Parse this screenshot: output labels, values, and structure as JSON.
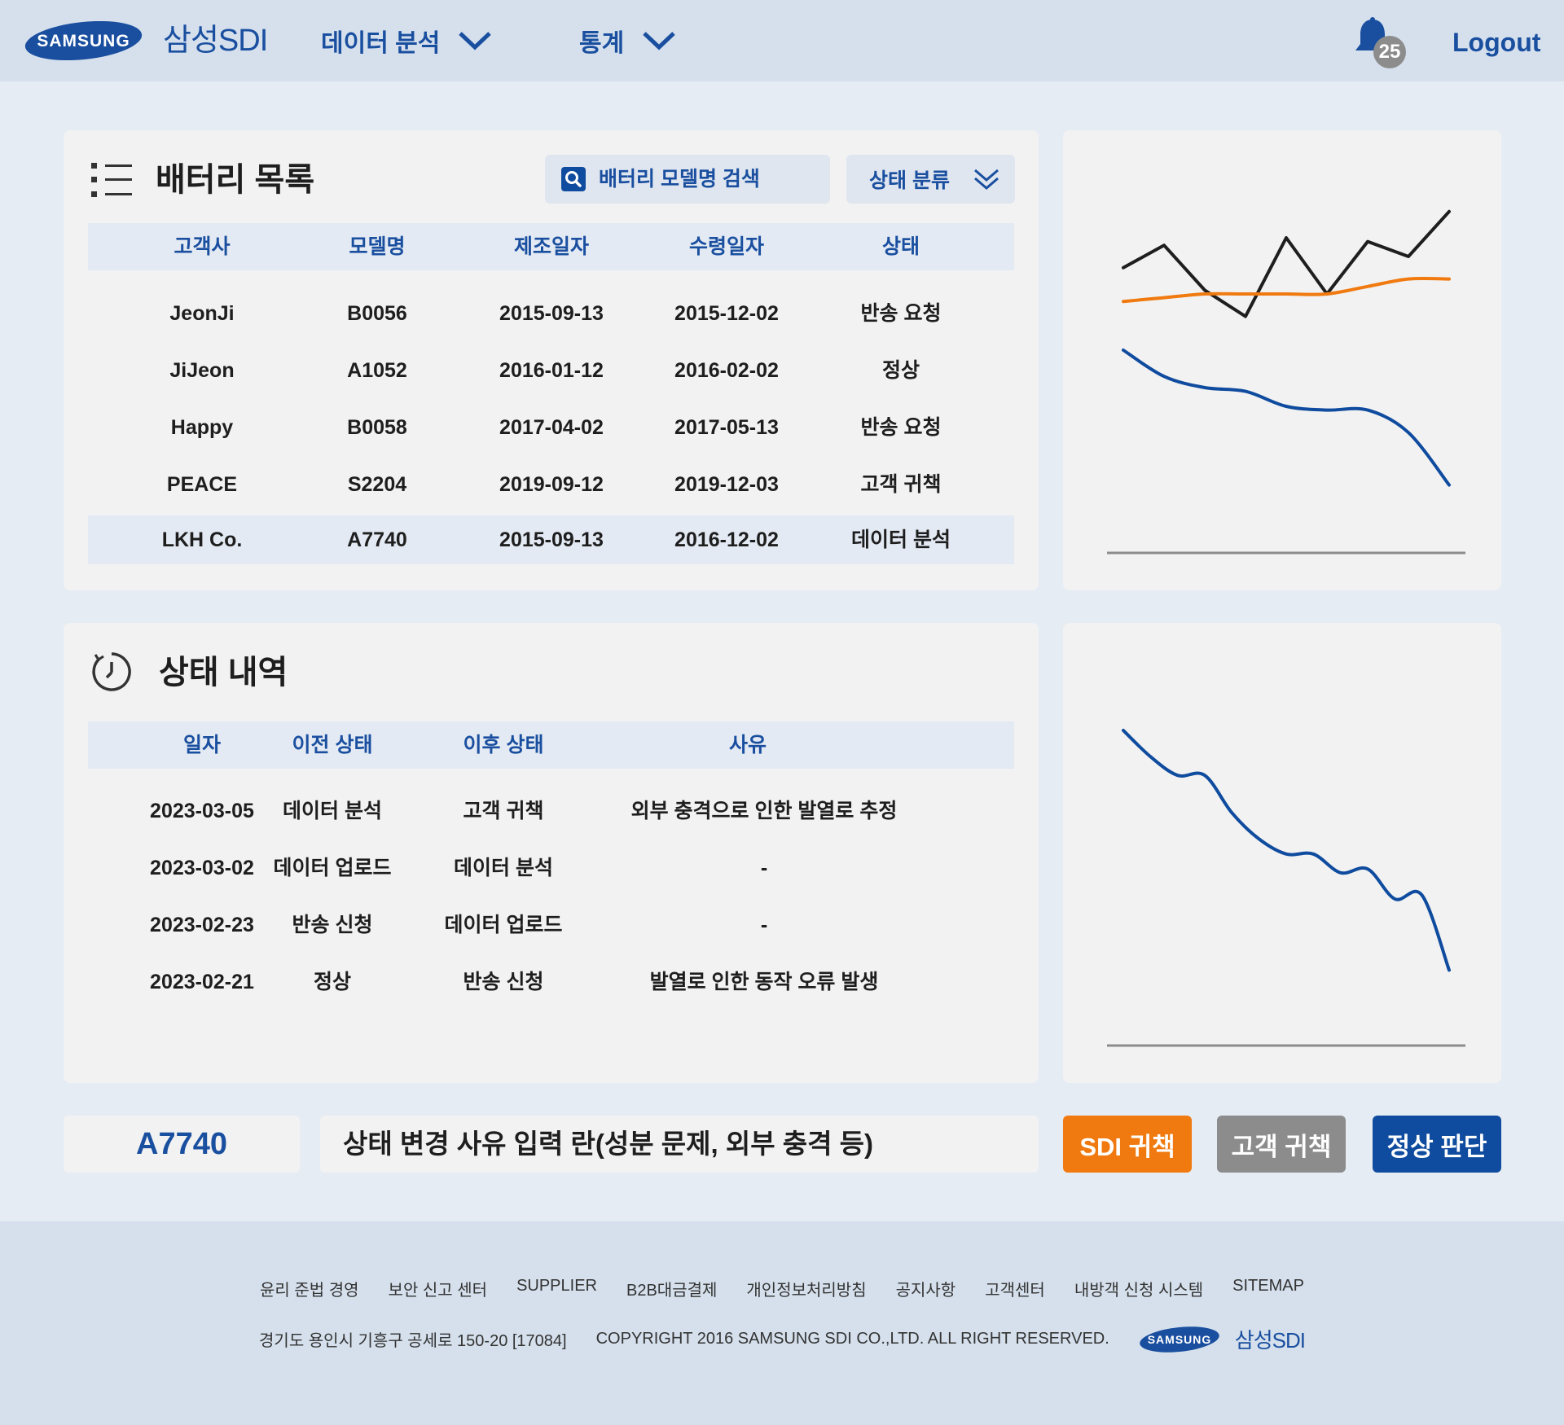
{
  "header": {
    "brand": "SAMSUNG",
    "sdi": "삼성SDI",
    "nav": [
      {
        "label": "데이터 분석"
      },
      {
        "label": "통계"
      }
    ],
    "notification_count": "25",
    "logout": "Logout"
  },
  "battery_panel": {
    "title": "배터리 목록",
    "search_placeholder": "배터리 모델명 검색",
    "filter_label": "상태 분류",
    "columns": [
      "고객사",
      "모델명",
      "제조일자",
      "수령일자",
      "상태"
    ],
    "rows": [
      {
        "customer": "JeonJi",
        "model": "B0056",
        "made": "2015-09-13",
        "received": "2015-12-02",
        "status": "반송 요청"
      },
      {
        "customer": "JiJeon",
        "model": "A1052",
        "made": "2016-01-12",
        "received": "2016-02-02",
        "status": "정상"
      },
      {
        "customer": "Happy",
        "model": "B0058",
        "made": "2017-04-02",
        "received": "2017-05-13",
        "status": "반송 요청"
      },
      {
        "customer": "PEACE",
        "model": "S2204",
        "made": "2019-09-12",
        "received": "2019-12-03",
        "status": "고객 귀책"
      },
      {
        "customer": "LKH Co.",
        "model": "A7740",
        "made": "2015-09-13",
        "received": "2016-12-02",
        "status": "데이터 분석"
      }
    ]
  },
  "history_panel": {
    "title": "상태 내역",
    "columns": [
      "일자",
      "이전 상태",
      "이후 상태",
      "사유"
    ],
    "rows": [
      {
        "date": "2023-03-05",
        "before": "데이터 분석",
        "after": "고객 귀책",
        "reason": "외부 충격으로 인한 발열로 추정"
      },
      {
        "date": "2023-03-02",
        "before": "데이터 업로드",
        "after": "데이터 분석",
        "reason": "-"
      },
      {
        "date": "2023-02-23",
        "before": "반송 신청",
        "after": "데이터 업로드",
        "reason": "-"
      },
      {
        "date": "2023-02-21",
        "before": "정상",
        "after": "반송 신청",
        "reason": "발열로 인한 동작 오류 발생"
      }
    ]
  },
  "chart_data": [
    {
      "type": "line",
      "title": "",
      "xlabel": "",
      "ylabel": "",
      "x": [
        0,
        1,
        2,
        3,
        4,
        5,
        6,
        7,
        8
      ],
      "ylim": [
        0,
        100
      ],
      "grid": false,
      "series": [
        {
          "color": "#1e1e1e",
          "values": [
            72,
            78,
            66,
            59,
            80,
            65,
            79,
            75,
            87
          ]
        },
        {
          "color": "#f07a0f",
          "values": [
            63,
            64,
            65,
            65,
            65,
            65,
            67,
            69,
            69
          ]
        },
        {
          "color": "#0f4b9e",
          "values": [
            50,
            43,
            40,
            39,
            35,
            34,
            34,
            28,
            14
          ]
        }
      ]
    },
    {
      "type": "line",
      "title": "",
      "xlabel": "",
      "ylabel": "",
      "x": [
        0,
        1,
        2,
        3,
        4,
        5,
        6,
        7,
        8,
        9,
        10,
        11,
        12
      ],
      "ylim": [
        0,
        100
      ],
      "grid": false,
      "series": [
        {
          "color": "#0f4b9e",
          "values": [
            80,
            73,
            68,
            68,
            58,
            51,
            47,
            47,
            42,
            43,
            35,
            36,
            16
          ]
        }
      ]
    }
  ],
  "action_bar": {
    "model": "A7740",
    "reason_placeholder": "상태 변경 사유 입력 란(성분 문제, 외부 충격 등)",
    "buttons": {
      "sdi": "SDI 귀책",
      "customer": "고객 귀책",
      "normal": "정상 판단"
    },
    "colors": {
      "sdi": "#f07a0f",
      "customer": "#8c8c8c",
      "normal": "#0f4b9e"
    }
  },
  "footer": {
    "links": [
      "윤리 준법 경영",
      "보안 신고 센터",
      "SUPPLIER",
      "B2B대금결제",
      "개인정보처리방침",
      "공지사항",
      "고객센터",
      "내방객 신청 시스템",
      "SITEMAP"
    ],
    "address": "경기도 용인시 기흥구 공세로 150-20 [17084]",
    "copyright": "COPYRIGHT 2016 SAMSUNG SDI CO.,LTD. ALL RIGHT RESERVED.",
    "brand": "SAMSUNG",
    "sdi": "삼성SDI"
  }
}
